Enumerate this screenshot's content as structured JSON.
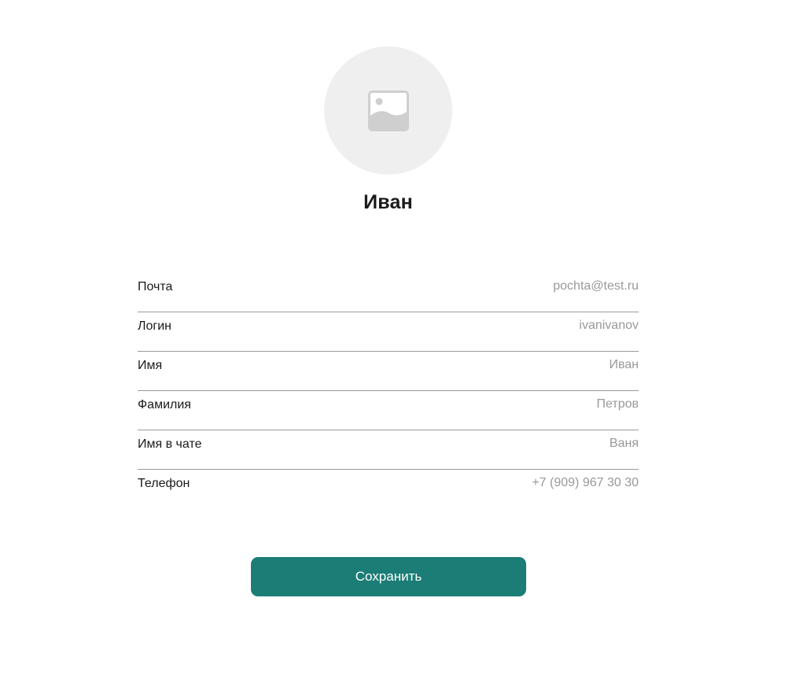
{
  "profile": {
    "avatar_icon": "image-placeholder-icon",
    "name": "Иван"
  },
  "fields": [
    {
      "label": "Почта",
      "value": "pochta@test.ru"
    },
    {
      "label": "Логин",
      "value": "ivanivanov"
    },
    {
      "label": "Имя",
      "value": "Иван"
    },
    {
      "label": "Фамилия",
      "value": "Петров"
    },
    {
      "label": "Имя в чате",
      "value": "Ваня"
    },
    {
      "label": "Телефон",
      "value": "+7 (909) 967 30 30"
    }
  ],
  "actions": {
    "save_label": "Сохранить"
  },
  "colors": {
    "accent": "#1b7d76",
    "avatar_bg": "#efefef",
    "value_text": "#999999",
    "divider": "#9a9a9a"
  }
}
